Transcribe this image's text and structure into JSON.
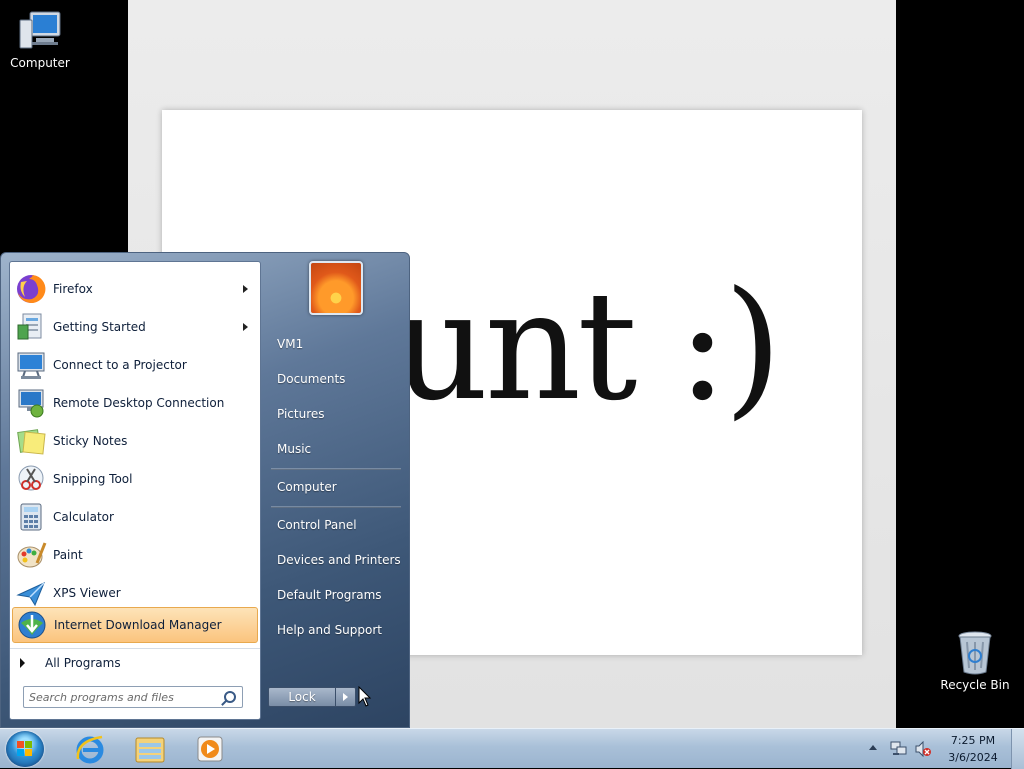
{
  "desktop": {
    "icons": [
      {
        "label": "Computer",
        "icon": "computer-icon"
      },
      {
        "label": "Recycle Bin",
        "icon": "recycle-bin-icon"
      }
    ]
  },
  "background_window": {
    "slide_text": "unt :)"
  },
  "start_menu": {
    "programs": [
      {
        "label": "Firefox",
        "icon": "firefox-icon",
        "has_submenu": true
      },
      {
        "label": "Getting Started",
        "icon": "getting-started-icon",
        "has_submenu": true
      },
      {
        "label": "Connect to a Projector",
        "icon": "projector-icon",
        "has_submenu": false
      },
      {
        "label": "Remote Desktop Connection",
        "icon": "remote-desktop-icon",
        "has_submenu": false
      },
      {
        "label": "Sticky Notes",
        "icon": "sticky-notes-icon",
        "has_submenu": false
      },
      {
        "label": "Snipping Tool",
        "icon": "snipping-tool-icon",
        "has_submenu": false
      },
      {
        "label": "Calculator",
        "icon": "calculator-icon",
        "has_submenu": false
      },
      {
        "label": "Paint",
        "icon": "paint-icon",
        "has_submenu": false
      },
      {
        "label": "XPS Viewer",
        "icon": "xps-viewer-icon",
        "has_submenu": false
      },
      {
        "label": "Internet Download Manager",
        "icon": "idm-icon",
        "has_submenu": false,
        "highlighted": true
      }
    ],
    "all_programs_label": "All Programs",
    "search_placeholder": "Search programs and files",
    "right_items": [
      {
        "label": "VM1"
      },
      {
        "label": "Documents"
      },
      {
        "label": "Pictures"
      },
      {
        "label": "Music"
      },
      {
        "label": "Computer"
      },
      {
        "label": "Control Panel"
      },
      {
        "label": "Devices and Printers"
      },
      {
        "label": "Default Programs"
      },
      {
        "label": "Help and Support"
      }
    ],
    "lock_label": "Lock"
  },
  "taskbar": {
    "pinned": [
      {
        "icon": "internet-explorer-icon"
      },
      {
        "icon": "file-explorer-icon"
      },
      {
        "icon": "media-player-icon"
      }
    ],
    "clock": {
      "time": "7:25 PM",
      "date": "3/6/2024"
    }
  },
  "colors": {
    "highlight": "#fbc47e",
    "taskbar": "#a9c0d8",
    "start_menu_right": "#3e5878"
  }
}
